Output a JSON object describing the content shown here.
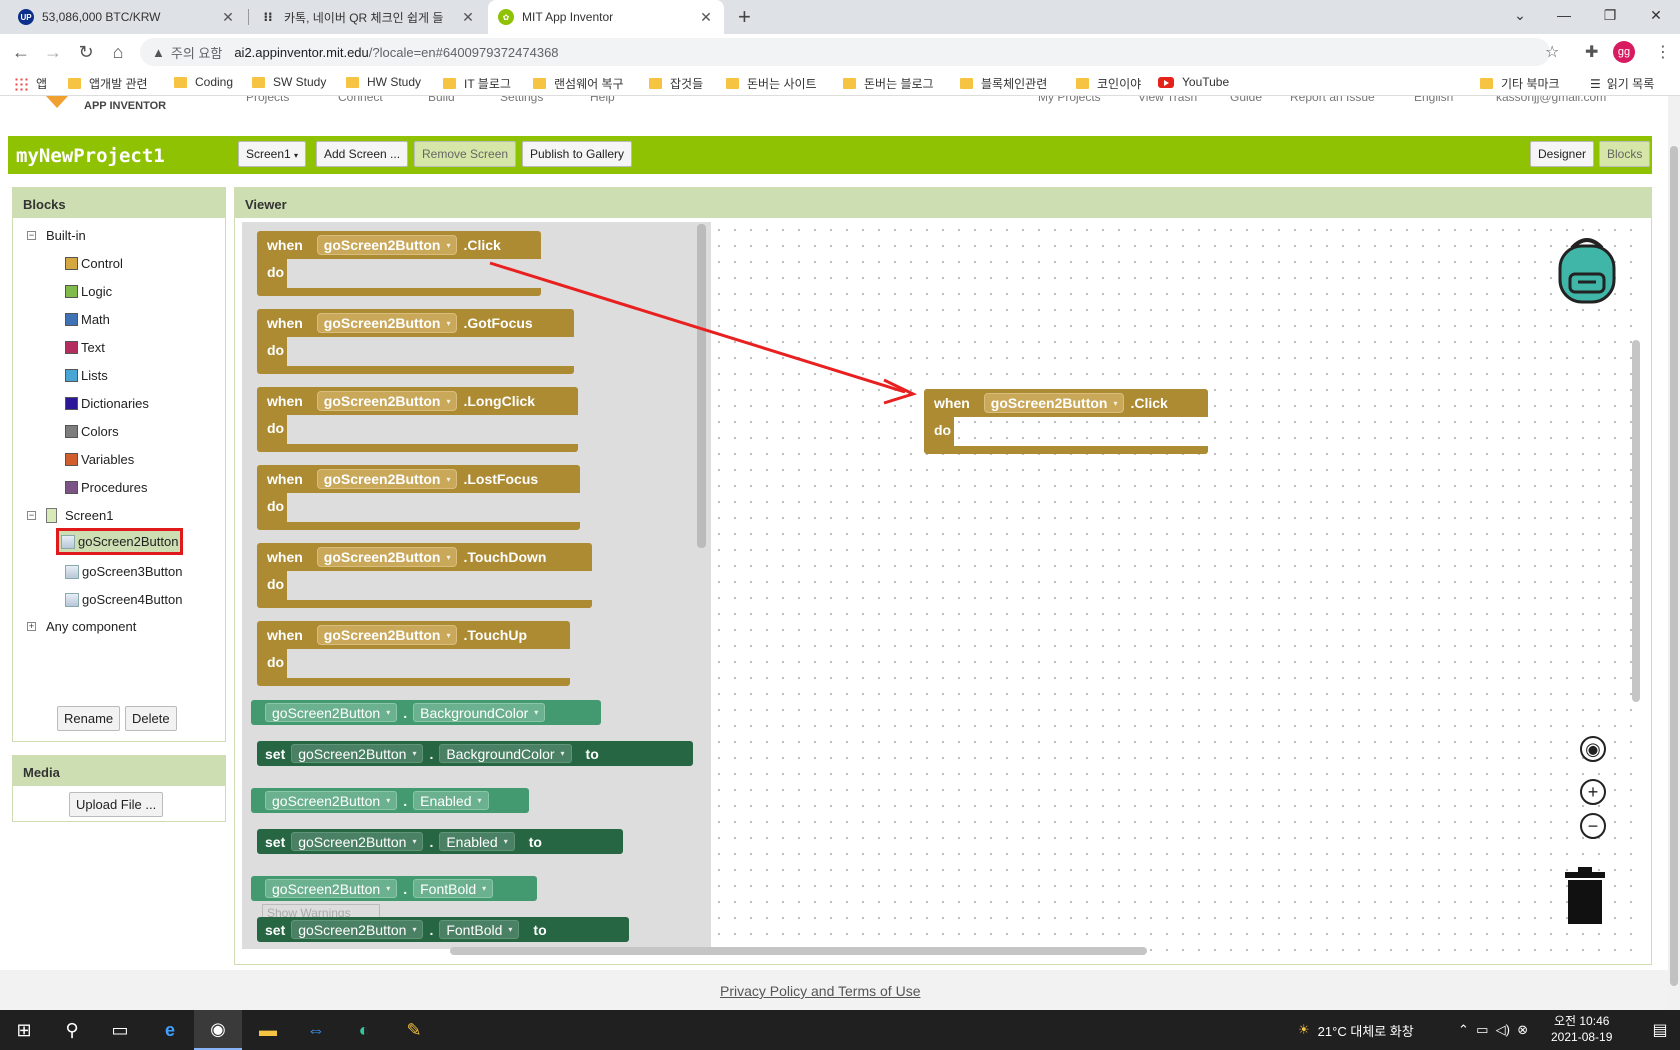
{
  "browser": {
    "tabs": [
      {
        "title": "53,086,000 BTC/KRW",
        "favicon": "upbit-icon"
      },
      {
        "title": "카톡, 네이버 QR 체크인 쉽게 들",
        "favicon": "dots-icon"
      },
      {
        "title": "MIT App Inventor",
        "favicon": "appinventor-icon",
        "active": true
      }
    ],
    "security_label": "주의 요함",
    "url_host": "ai2.appinventor.mit.edu",
    "url_path": "/?locale=en#6400979372474368",
    "profile_initials": "gg",
    "bookmarks": [
      "앱",
      "앱개발 관련",
      "Coding",
      "SW Study",
      "HW Study",
      "IT 블로그",
      "랜섬웨어 복구",
      "잡것들",
      "돈버는 사이트",
      "돈버는 블로그",
      "블록체인관련",
      "코인이야",
      "YouTube"
    ],
    "other_bookmarks": "기타 북마크",
    "reading_list": "읽기 목록"
  },
  "appinventor": {
    "logo_text": "APP INVENTOR",
    "top_menu": [
      "Projects",
      "Connect",
      "Build",
      "Settings",
      "Help"
    ],
    "top_menu_right": [
      "My Projects",
      "View Trash",
      "Guide",
      "Report an Issue",
      "English",
      "kassonjj@gmail.com"
    ],
    "project_name": "myNewProject1",
    "screen_select": "Screen1",
    "add_screen": "Add Screen ...",
    "remove_screen": "Remove Screen",
    "publish": "Publish to Gallery",
    "designer": "Designer",
    "blocks": "Blocks"
  },
  "blocks_panel": {
    "header": "Blocks",
    "builtin_label": "Built-in",
    "builtin": [
      {
        "label": "Control",
        "color": "#d4a840"
      },
      {
        "label": "Logic",
        "color": "#7fba4a"
      },
      {
        "label": "Math",
        "color": "#3f71b5"
      },
      {
        "label": "Text",
        "color": "#b32d5e"
      },
      {
        "label": "Lists",
        "color": "#49a6d4"
      },
      {
        "label": "Dictionaries",
        "color": "#2d1799"
      },
      {
        "label": "Colors",
        "color": "#7d7d7d"
      },
      {
        "label": "Variables",
        "color": "#d05f2d"
      },
      {
        "label": "Procedures",
        "color": "#7c5385"
      }
    ],
    "screen_label": "Screen1",
    "components": [
      "goScreen2Button",
      "goScreen3Button",
      "goScreen4Button"
    ],
    "any_component": "Any component",
    "rename": "Rename",
    "delete": "Delete"
  },
  "media_panel": {
    "header": "Media",
    "upload": "Upload File ..."
  },
  "viewer": {
    "header": "Viewer",
    "kw_when": "when",
    "kw_do": "do",
    "kw_set": "set",
    "kw_to": "to",
    "component": "goScreen2Button",
    "events": [
      ".Click",
      ".GotFocus",
      ".LongClick",
      ".LostFocus",
      ".TouchDown",
      ".TouchUp"
    ],
    "property_blocks": [
      {
        "kind": "get",
        "prop": "BackgroundColor"
      },
      {
        "kind": "set",
        "prop": "BackgroundColor"
      },
      {
        "kind": "get",
        "prop": "Enabled"
      },
      {
        "kind": "set",
        "prop": "Enabled"
      },
      {
        "kind": "get",
        "prop": "FontBold"
      },
      {
        "kind": "set",
        "prop": "FontBold"
      }
    ],
    "placed_block_event": ".Click",
    "show_warnings": "Show Warnings"
  },
  "footer": {
    "link": "Privacy Policy and Terms of Use"
  },
  "taskbar": {
    "weather": "21°C  대체로 화창",
    "time": "오전 10:46",
    "date": "2021-08-19"
  }
}
